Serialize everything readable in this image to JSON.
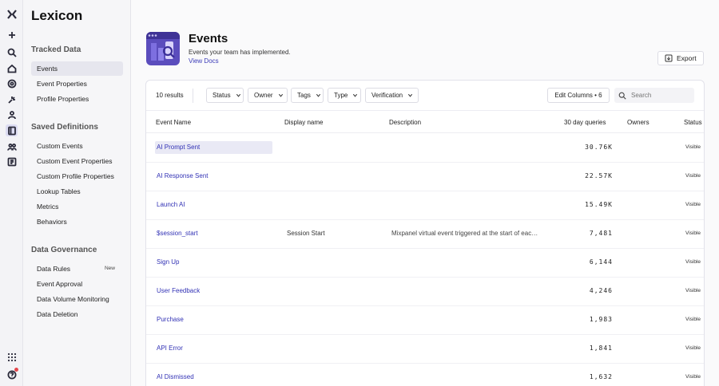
{
  "app": {
    "name": "Lexicon"
  },
  "sidebar": {
    "sections": [
      {
        "title": "Tracked Data",
        "items": [
          {
            "label": "Events",
            "active": true
          },
          {
            "label": "Event Properties"
          },
          {
            "label": "Profile Properties"
          }
        ]
      },
      {
        "title": "Saved Definitions",
        "items": [
          {
            "label": "Custom Events"
          },
          {
            "label": "Custom Event Properties"
          },
          {
            "label": "Custom Profile Properties"
          },
          {
            "label": "Lookup Tables"
          },
          {
            "label": "Metrics"
          },
          {
            "label": "Behaviors"
          }
        ]
      },
      {
        "title": "Data Governance",
        "items": [
          {
            "label": "Data Rules",
            "badge": "New"
          },
          {
            "label": "Event Approval"
          },
          {
            "label": "Data Volume Monitoring"
          },
          {
            "label": "Data Deletion"
          }
        ]
      }
    ]
  },
  "header": {
    "title": "Events",
    "subtitle": "Events your team has implemented.",
    "docs_link": "View Docs",
    "export_label": "Export"
  },
  "toolbar": {
    "results": "10 results",
    "filters": [
      "Status",
      "Owner",
      "Tags",
      "Type",
      "Verification"
    ],
    "edit_columns": "Edit Columns • 6",
    "search_placeholder": "Search"
  },
  "table": {
    "columns": [
      "Event Name",
      "Display name",
      "Description",
      "30 day queries",
      "Owners",
      "Status"
    ],
    "rows": [
      {
        "name": "AI Prompt Sent",
        "display": "",
        "description": "",
        "queries": "30.76K",
        "status": "Visible",
        "highlight": true
      },
      {
        "name": "AI Response Sent",
        "display": "",
        "description": "",
        "queries": "22.57K",
        "status": "Visible"
      },
      {
        "name": "Launch AI",
        "display": "",
        "description": "",
        "queries": "15.49K",
        "status": "Visible"
      },
      {
        "name": "$session_start",
        "display": "Session Start",
        "description": "Mixpanel virtual event triggered at the start of eac…",
        "queries": "7,481",
        "status": "Visible"
      },
      {
        "name": "Sign Up",
        "display": "",
        "description": "",
        "queries": "6,144",
        "status": "Visible"
      },
      {
        "name": "User Feedback",
        "display": "",
        "description": "",
        "queries": "4,246",
        "status": "Visible"
      },
      {
        "name": "Purchase",
        "display": "",
        "description": "",
        "queries": "1,983",
        "status": "Visible"
      },
      {
        "name": "API Error",
        "display": "",
        "description": "",
        "queries": "1,841",
        "status": "Visible"
      },
      {
        "name": "AI Dismissed",
        "display": "",
        "description": "",
        "queries": "1,632",
        "status": "Visible"
      }
    ]
  },
  "rail_icons": [
    "logo-icon",
    "add-icon",
    "search-icon",
    "home-icon",
    "target-icon",
    "spark-icon",
    "users-icon",
    "lexicon-icon",
    "group-icon",
    "reports-icon",
    "apps-grid-icon",
    "help-icon"
  ],
  "colors": {
    "accent": "#3232b5",
    "hero": "#5b4dbd",
    "notify": "#e5484d"
  }
}
